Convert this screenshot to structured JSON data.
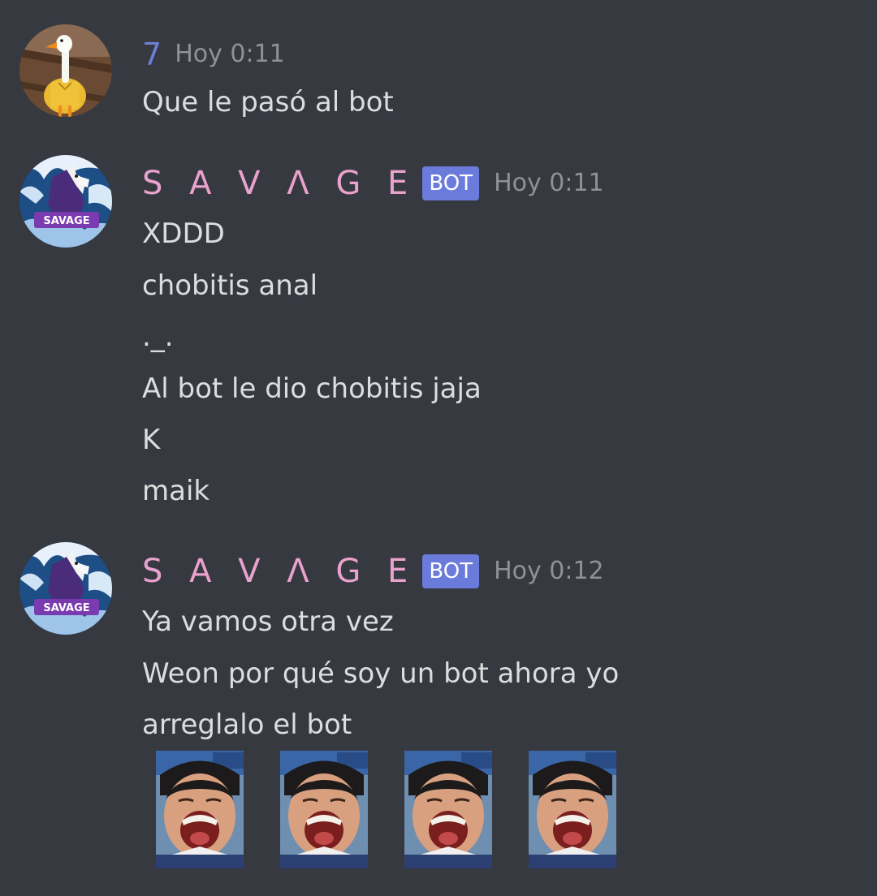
{
  "messages": [
    {
      "author": "7",
      "avatar_icon": "goose-avatar-icon",
      "timestamp": "Hoy 0:11",
      "is_bot": false,
      "lines": [
        "Que le pasó al bot"
      ]
    },
    {
      "author": "S A V Λ G E",
      "avatar_icon": "wolf-savage-avatar-icon",
      "bot_tag": "BOT",
      "timestamp": "Hoy 0:11",
      "is_bot": true,
      "lines": [
        "XDDD",
        "chobitis anal",
        "._.",
        "Al bot le dio chobitis jaja",
        "K",
        "maik"
      ]
    },
    {
      "author": "S A V Λ G E",
      "avatar_icon": "wolf-savage-avatar-icon",
      "bot_tag": "BOT",
      "timestamp": "Hoy 0:12",
      "is_bot": true,
      "lines": [
        "Ya vamos otra vez",
        "Weon por qué soy un bot ahora yo",
        "arreglalo el bot"
      ],
      "emojis": [
        "laughing-boy-emoji",
        "laughing-boy-emoji",
        "laughing-boy-emoji",
        "laughing-boy-emoji"
      ]
    }
  ],
  "colors": {
    "background": "#36393f",
    "message_text": "#dcddde",
    "timestamp": "#8e9297",
    "bot_username": "#e9a1cd",
    "user_username": "#6d7fd6",
    "bot_tag": "#6b7bdc"
  }
}
